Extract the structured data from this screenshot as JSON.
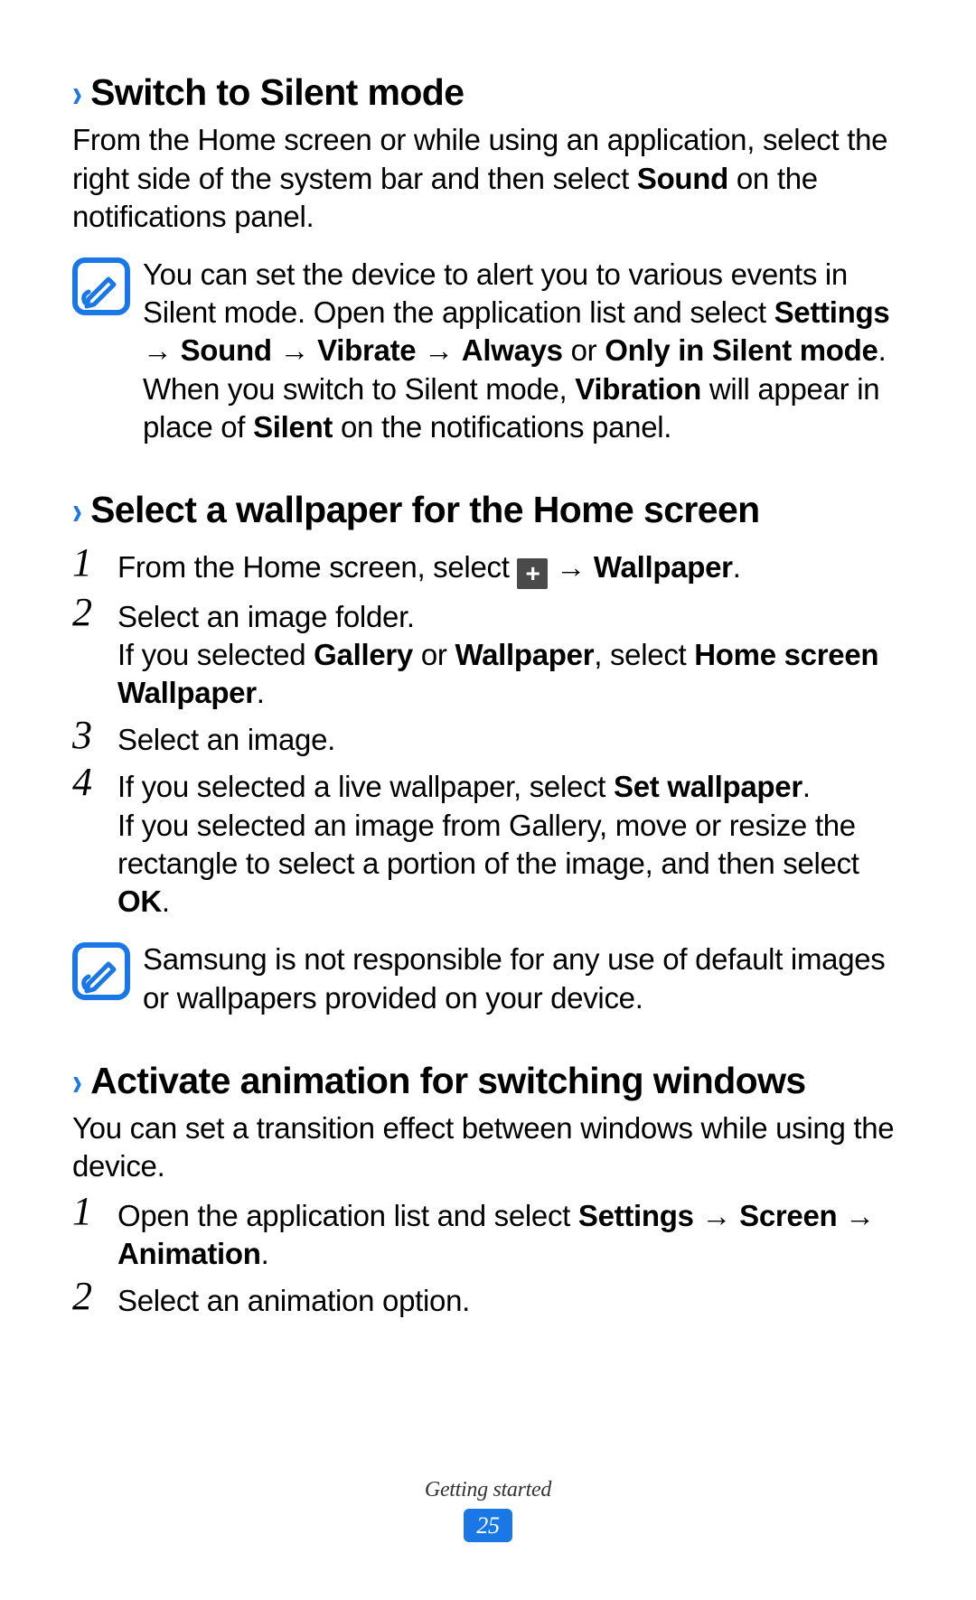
{
  "sections": {
    "silent": {
      "heading": "Switch to Silent mode",
      "intro_html": "From the Home screen or while using an application, select the right side of the system bar and then select <b>Sound</b> on the notifications panel.",
      "note_html": "You can set the device to alert you to various events in Silent mode. Open the application list and select <b>Settings</b> → <b>Sound</b> → <b>Vibrate</b> → <b>Always</b> or <b>Only in Silent mode</b>. When you switch to Silent mode, <b>Vibration</b> will appear in place of <b>Silent</b> on the notifications panel."
    },
    "wallpaper": {
      "heading": "Select a wallpaper for the Home screen",
      "steps": [
        {
          "num": "1",
          "html": "From the Home screen, select {{PLUS}} → <b>Wallpaper</b>."
        },
        {
          "num": "2",
          "html": "Select an image folder.<br>If you selected <b>Gallery</b> or <b>Wallpaper</b>, select <b>Home screen Wallpaper</b>."
        },
        {
          "num": "3",
          "html": "Select an image."
        },
        {
          "num": "4",
          "html": "If you selected a live wallpaper, select <b>Set wallpaper</b>.<br>If you selected an image from Gallery, move or resize the rectangle to select a portion of the image, and then select <b>OK</b>."
        }
      ],
      "note_html": "Samsung is not responsible for any use of default images or wallpapers provided on your device."
    },
    "animation": {
      "heading": "Activate animation for switching windows",
      "intro_html": "You can set a transition effect between windows while using the device.",
      "steps": [
        {
          "num": "1",
          "html": "Open the application list and select <b>Settings</b> → <b>Screen</b> → <b>Animation</b>."
        },
        {
          "num": "2",
          "html": "Select an animation option."
        }
      ]
    }
  },
  "footer": {
    "section_label": "Getting started",
    "page_number": "25"
  }
}
